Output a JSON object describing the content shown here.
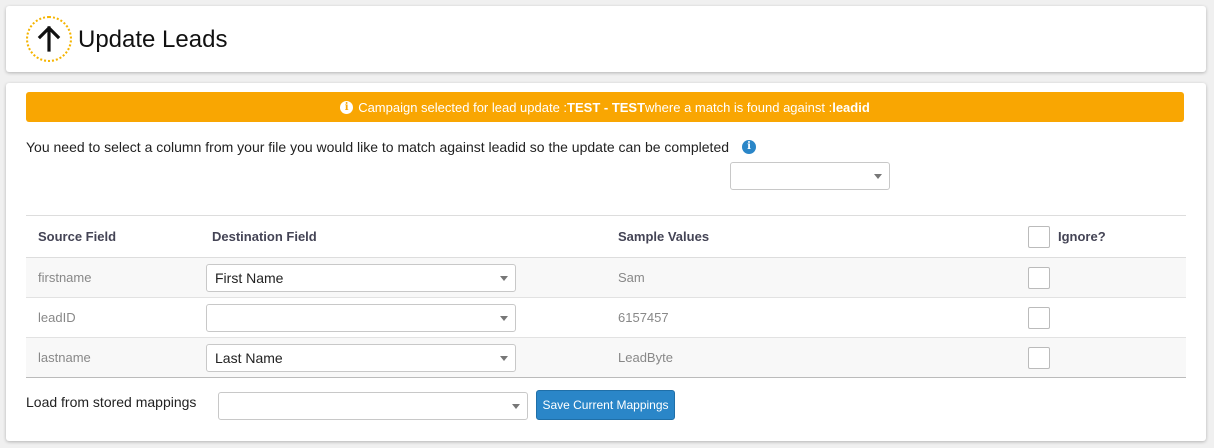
{
  "header": {
    "title": "Update Leads",
    "icon": "arrow-up-icon",
    "icon_ring_color": "#f5b400"
  },
  "alert": {
    "prefix": "Campaign selected for lead update : ",
    "campaign": "TEST - TEST",
    "middle": " where a match is found against : ",
    "match_field": "leadid",
    "color": "#f9a602"
  },
  "instruction": {
    "text": "You need to select a column from your file you would like to match against leadid so the update can be completed",
    "match_select_value": ""
  },
  "table": {
    "headers": {
      "source": "Source Field",
      "destination": "Destination Field",
      "sample": "Sample Values",
      "ignore": "Ignore?"
    },
    "rows": [
      {
        "source": "firstname",
        "destination": "First Name",
        "sample": "Sam",
        "ignore": false
      },
      {
        "source": "leadID",
        "destination": "",
        "sample": "6157457",
        "ignore": false
      },
      {
        "source": "lastname",
        "destination": "Last Name",
        "sample": "LeadByte",
        "ignore": false
      }
    ]
  },
  "footer": {
    "stored_label": "Load from stored mappings",
    "stored_select_value": "",
    "save_label": "Save Current Mappings",
    "save_color": "#2a86c8"
  }
}
